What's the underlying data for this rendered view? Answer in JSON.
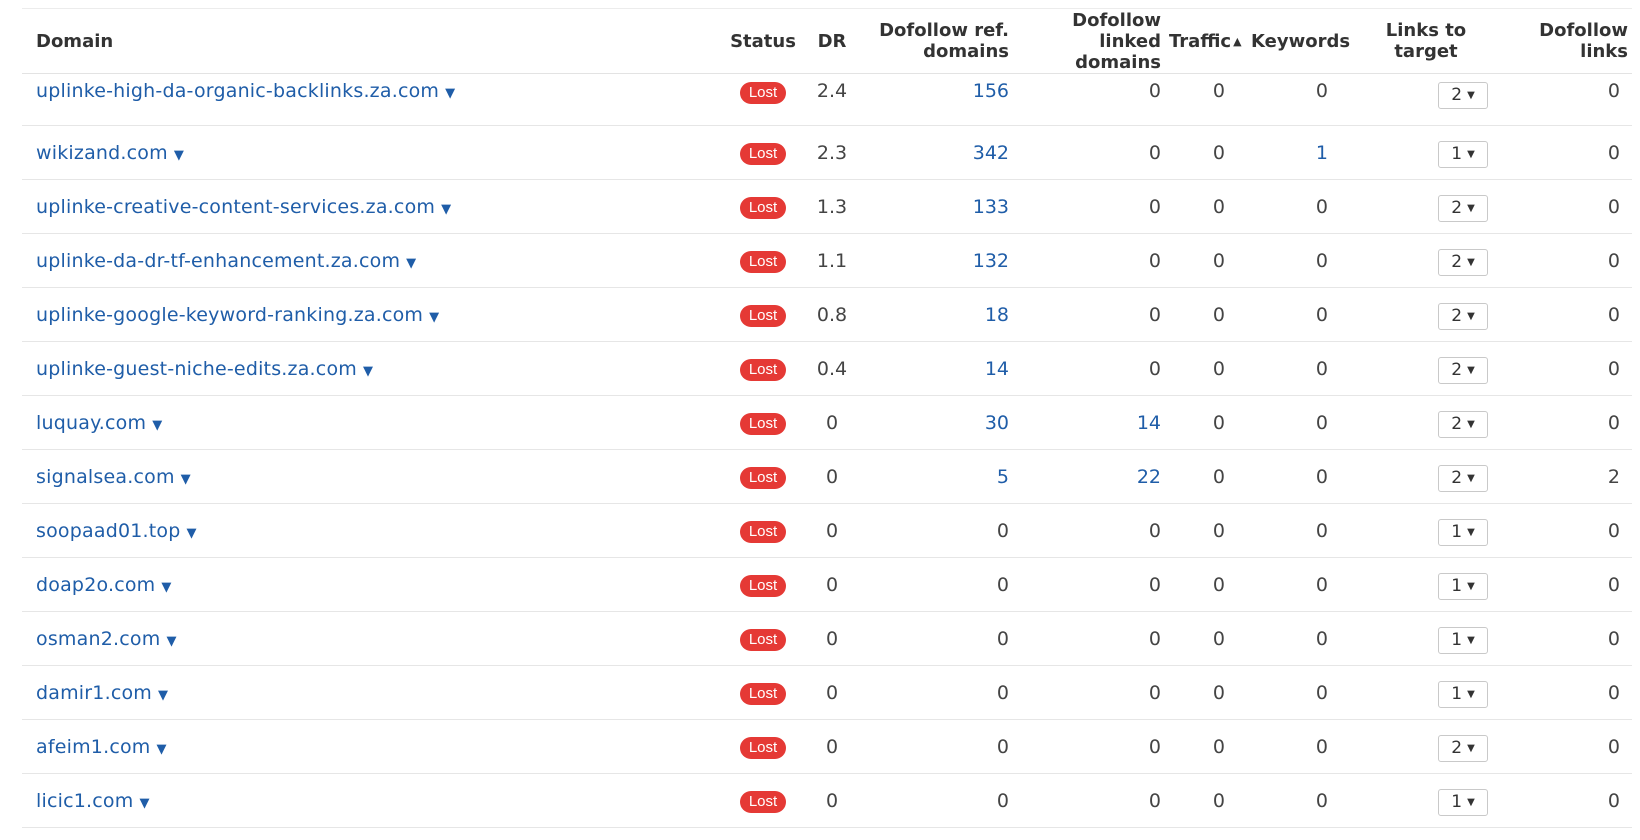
{
  "headers": {
    "domain": "Domain",
    "status": "Status",
    "dr": "DR",
    "dofollow_ref_domains_1": "Dofollow ref.",
    "dofollow_ref_domains_2": "domains",
    "dofollow_linked_domains_1": "Dofollow linked",
    "dofollow_linked_domains_2": "domains",
    "traffic": "Traffic",
    "traffic_sort_icon": "▲",
    "keywords": "Keywords",
    "links_to_target": "Links to target",
    "dofollow_links_1": "Dofollow",
    "dofollow_links_2": "links"
  },
  "icons": {
    "domain_caret": "▼",
    "select_caret": "▼"
  },
  "colors": {
    "link": "#1f5da8",
    "lost_badge": "#e53935"
  },
  "rows": [
    {
      "domain": "uplinke-high-da-organic-backlinks.za.com",
      "status": "Lost",
      "dr": "2.4",
      "ref_domains": "156",
      "linked_domains": "0",
      "traffic": "0",
      "keywords": "0",
      "links_to_target": "2",
      "dofollow_links": "0"
    },
    {
      "domain": "wikizand.com",
      "status": "Lost",
      "dr": "2.3",
      "ref_domains": "342",
      "linked_domains": "0",
      "traffic": "0",
      "keywords": "1",
      "links_to_target": "1",
      "dofollow_links": "0"
    },
    {
      "domain": "uplinke-creative-content-services.za.com",
      "status": "Lost",
      "dr": "1.3",
      "ref_domains": "133",
      "linked_domains": "0",
      "traffic": "0",
      "keywords": "0",
      "links_to_target": "2",
      "dofollow_links": "0"
    },
    {
      "domain": "uplinke-da-dr-tf-enhancement.za.com",
      "status": "Lost",
      "dr": "1.1",
      "ref_domains": "132",
      "linked_domains": "0",
      "traffic": "0",
      "keywords": "0",
      "links_to_target": "2",
      "dofollow_links": "0"
    },
    {
      "domain": "uplinke-google-keyword-ranking.za.com",
      "status": "Lost",
      "dr": "0.8",
      "ref_domains": "18",
      "linked_domains": "0",
      "traffic": "0",
      "keywords": "0",
      "links_to_target": "2",
      "dofollow_links": "0"
    },
    {
      "domain": "uplinke-guest-niche-edits.za.com",
      "status": "Lost",
      "dr": "0.4",
      "ref_domains": "14",
      "linked_domains": "0",
      "traffic": "0",
      "keywords": "0",
      "links_to_target": "2",
      "dofollow_links": "0"
    },
    {
      "domain": "luquay.com",
      "status": "Lost",
      "dr": "0",
      "ref_domains": "30",
      "linked_domains": "14",
      "traffic": "0",
      "keywords": "0",
      "links_to_target": "2",
      "dofollow_links": "0"
    },
    {
      "domain": "signalsea.com",
      "status": "Lost",
      "dr": "0",
      "ref_domains": "5",
      "linked_domains": "22",
      "traffic": "0",
      "keywords": "0",
      "links_to_target": "2",
      "dofollow_links": "2"
    },
    {
      "domain": "soopaad01.top",
      "status": "Lost",
      "dr": "0",
      "ref_domains": "0",
      "linked_domains": "0",
      "traffic": "0",
      "keywords": "0",
      "links_to_target": "1",
      "dofollow_links": "0"
    },
    {
      "domain": "doap2o.com",
      "status": "Lost",
      "dr": "0",
      "ref_domains": "0",
      "linked_domains": "0",
      "traffic": "0",
      "keywords": "0",
      "links_to_target": "1",
      "dofollow_links": "0"
    },
    {
      "domain": "osman2.com",
      "status": "Lost",
      "dr": "0",
      "ref_domains": "0",
      "linked_domains": "0",
      "traffic": "0",
      "keywords": "0",
      "links_to_target": "1",
      "dofollow_links": "0"
    },
    {
      "domain": "damir1.com",
      "status": "Lost",
      "dr": "0",
      "ref_domains": "0",
      "linked_domains": "0",
      "traffic": "0",
      "keywords": "0",
      "links_to_target": "1",
      "dofollow_links": "0"
    },
    {
      "domain": "afeim1.com",
      "status": "Lost",
      "dr": "0",
      "ref_domains": "0",
      "linked_domains": "0",
      "traffic": "0",
      "keywords": "0",
      "links_to_target": "2",
      "dofollow_links": "0"
    },
    {
      "domain": "licic1.com",
      "status": "Lost",
      "dr": "0",
      "ref_domains": "0",
      "linked_domains": "0",
      "traffic": "0",
      "keywords": "0",
      "links_to_target": "1",
      "dofollow_links": "0"
    }
  ]
}
